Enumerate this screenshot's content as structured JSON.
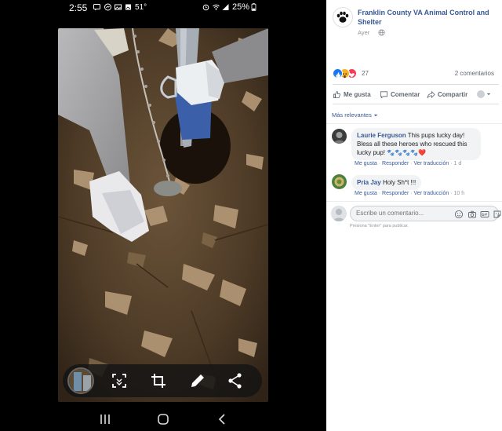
{
  "status_bar": {
    "time": "2:55",
    "temperature": "51°",
    "battery": "25%",
    "icons": [
      "messages-icon",
      "messenger-icon",
      "gallery-icon",
      "image-icon",
      "alarm-icon",
      "wifi-icon",
      "signal-icon",
      "battery-icon"
    ]
  },
  "photo": {
    "description_icon": "photo-content",
    "toolbar": [
      "thumbnail-preview",
      "scan-icon",
      "crop-icon",
      "edit-pencil-icon",
      "share-icon"
    ]
  },
  "nav_bar": [
    "recent-apps-icon",
    "home-icon",
    "back-icon"
  ],
  "post": {
    "page_name": "Franklin County VA Animal Control and Shelter",
    "time": "Ayer",
    "audience_icon": "globe-icon",
    "reaction_count": "27",
    "reaction_types": [
      "like-reaction-icon",
      "wow-reaction-icon",
      "love-reaction-icon"
    ],
    "comment_count": "2 comentarios",
    "actions": {
      "like": "Me gusta",
      "comment": "Comentar",
      "share": "Compartir"
    },
    "sort_label": "Más relevantes",
    "comments": [
      {
        "author": "Laurie Ferguson",
        "text": "This pups lucky day! Bless all these heroes who rescued this lucky pup! 🐾🐾🐾🐾❤️",
        "like": "Me gusta",
        "reply": "Responder",
        "translate": "Ver traducción",
        "time": "1 d"
      },
      {
        "author": "Pria Jay",
        "text": "Holy Sh*t !!!",
        "like": "Me gusta",
        "reply": "Responder",
        "translate": "Ver traducción",
        "time": "10 h"
      }
    ],
    "composer": {
      "placeholder": "Escribe un comentario...",
      "hint": "Presiona \"Enter\" para publicar."
    },
    "colors": {
      "link": "#385898",
      "muted": "#90949c",
      "like_blue": "#1877f2",
      "love_red": "#f33e58",
      "wow_yellow": "#f7b125"
    }
  }
}
